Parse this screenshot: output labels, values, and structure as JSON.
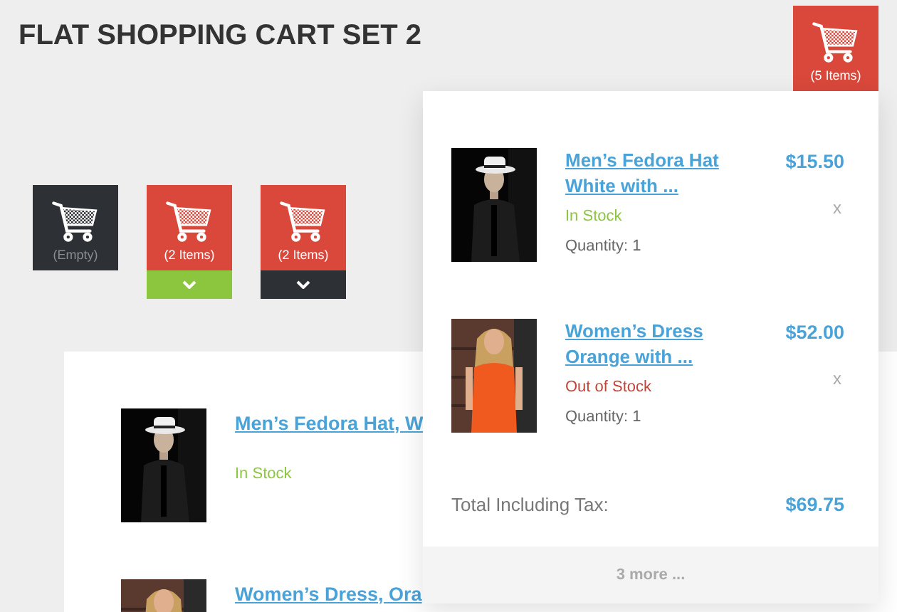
{
  "title": "FLAT SHOPPING CART SET 2",
  "header_cart": {
    "count": "(5 Items)"
  },
  "cart_buttons": [
    {
      "kind": "empty",
      "count": "(Empty)"
    },
    {
      "kind": "dropdown",
      "count": "(2 Items)",
      "color": "#8cc63f"
    },
    {
      "kind": "dropdown",
      "count": "(2 Items)",
      "color": "#2d3035"
    }
  ],
  "cart_list": [
    {
      "name": "Men’s Fedora Hat, W",
      "stock": "In Stock",
      "in_stock": true
    },
    {
      "name": "Women’s Dress, Ora"
    }
  ],
  "dropdown": {
    "items": [
      {
        "name": "Men’s Fedora Hat White with ...",
        "price": "$15.50",
        "remove": "x",
        "stock": "In Stock",
        "in_stock": true,
        "quantity": "Quantity: 1"
      },
      {
        "name": "Women’s Dress Orange with ...",
        "price": "$52.00",
        "remove": "x",
        "stock": "Out of Stock",
        "in_stock": false,
        "quantity": "Quantity: 1"
      }
    ],
    "total_label": "Total Including Tax:",
    "total": "$69.75",
    "more": "3 more ..."
  }
}
